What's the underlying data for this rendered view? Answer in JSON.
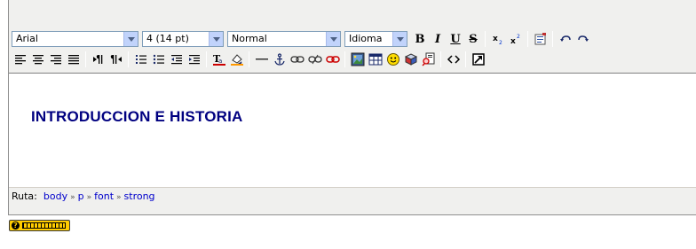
{
  "toolbar": {
    "font_family": "Arial",
    "font_size": "4 (14 pt)",
    "format": "Normal",
    "language": "Idioma",
    "bold_label": "B",
    "italic_label": "I",
    "underline_label": "U",
    "strike_label": "S"
  },
  "content": {
    "heading": "INTRODUCCION E HISTORIA"
  },
  "path": {
    "label": "Ruta:",
    "items": [
      "body",
      "p",
      "font",
      "strong"
    ],
    "separator": "»"
  },
  "colors": {
    "toolbar_bg": "#f0f0ee",
    "heading_color": "#000080",
    "link_color": "#0000cc",
    "keyboard_badge": "#ffcc00"
  },
  "icons": [
    "subscript-icon",
    "superscript-icon",
    "paste-word-icon",
    "undo-icon",
    "redo-icon",
    "align-left-icon",
    "align-center-icon",
    "align-right-icon",
    "justify-icon",
    "ltr-icon",
    "rtl-icon",
    "ordered-list-icon",
    "unordered-list-icon",
    "outdent-icon",
    "indent-icon",
    "text-color-icon",
    "background-color-icon",
    "horizontal-rule-icon",
    "anchor-icon",
    "link-icon",
    "unlink-icon",
    "nolink-icon",
    "image-icon",
    "table-icon",
    "smiley-icon",
    "special-char-icon",
    "search-replace-icon",
    "html-source-icon",
    "fullscreen-icon",
    "keyboard-shortcuts-icon"
  ]
}
